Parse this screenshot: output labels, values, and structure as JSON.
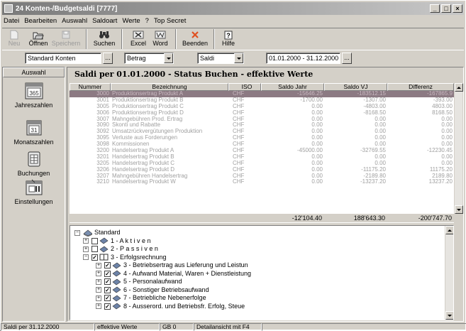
{
  "window": {
    "title": "24 Konten-/Budgetsaldi [7777]",
    "controls": [
      "_",
      "□",
      "×"
    ]
  },
  "menu": [
    "Datei",
    "Bearbeiten",
    "Auswahl",
    "Saldoart",
    "Werte",
    "?",
    "Top Secret"
  ],
  "toolbar": {
    "neu": "Neu",
    "oeffnen": "Öffnen",
    "speichern": "Speichern",
    "suchen": "Suchen",
    "excel": "Excel",
    "word": "Word",
    "beenden": "Beenden",
    "hilfe": "Hilfe"
  },
  "filters": {
    "konten": "Standard Konten",
    "dots": "...",
    "betrag": "Betrag",
    "saldi": "Saldi",
    "period": "01.01.2000 - 31.12.2000"
  },
  "sidebar": {
    "header": "Auswahl",
    "items": [
      {
        "label": "Jahreszahlen",
        "icon_text": "365"
      },
      {
        "label": "Monatszahlen",
        "icon_text": "31"
      },
      {
        "label": "Buchungen"
      },
      {
        "label": "Einstellungen"
      }
    ]
  },
  "main": {
    "title": "Saldi per 01.01.2000 - Status Buchen - effektive Werte"
  },
  "table": {
    "columns": [
      "Nummer",
      "Bezeichnung",
      "ISO",
      "Saldo Jahr",
      "Saldo VJ",
      "Differenz"
    ],
    "rows": [
      [
        "3000",
        "Produktionsertrag Produkt A",
        "CHF",
        "-15646.25",
        "-183512.15",
        "-167865.9"
      ],
      [
        "3001",
        "Produktionsertrag Produkt B",
        "CHF",
        "-1700.00",
        "-1307.00",
        "-393.00"
      ],
      [
        "3005",
        "Produktionsertrag Produkt C",
        "CHF",
        "0.00",
        "-4803.00",
        "4803.00"
      ],
      [
        "3006",
        "Produktionsertrag Produkt D",
        "CHF",
        "0.00",
        "-8168.50",
        "8168.50"
      ],
      [
        "3007",
        "Mahngebühren Prod. Ertrag",
        "CHF",
        "0.00",
        "0.00",
        "0.00"
      ],
      [
        "3090",
        "Skonti und Rabatte",
        "CHF",
        "0.00",
        "0.00",
        "0.00"
      ],
      [
        "3092",
        "Umsatzrückvergütungen Produktion",
        "CHF",
        "0.00",
        "0.00",
        "0.00"
      ],
      [
        "3095",
        "Verluste aus Forderungen",
        "CHF",
        "0.00",
        "0.00",
        "0.00"
      ],
      [
        "3098",
        "Kommissionen",
        "CHF",
        "0.00",
        "0.00",
        "0.00"
      ],
      [
        "3200",
        "Handelsertrag Produkt A",
        "CHF",
        "-45000.00",
        "-32769.55",
        "-12230.45"
      ],
      [
        "3201",
        "Handelsertrag Produkt B",
        "CHF",
        "0.00",
        "0.00",
        "0.00"
      ],
      [
        "3205",
        "Handelsertrag Produkt C",
        "CHF",
        "0.00",
        "0.00",
        "0.00"
      ],
      [
        "3206",
        "Handelsertrag Produkt D",
        "CHF",
        "0.00",
        "-11175.20",
        "11175.20"
      ],
      [
        "3207",
        "Mahngebühren Handelsertrag",
        "CHF",
        "0.00",
        "-2189.80",
        "2189.80"
      ],
      [
        "3210",
        "Handelsertrag Produkt W",
        "CHF",
        "0.00",
        "-13237.20",
        "13237.20"
      ]
    ],
    "totals": [
      "-12'104.40",
      "188'643.30",
      "-200'747.70"
    ]
  },
  "tree": [
    {
      "label": "Standard",
      "pm": "−",
      "level": 0,
      "checkbox": null
    },
    {
      "label": "1 - A k t i v e n",
      "pm": "+",
      "level": 1,
      "checkbox": ""
    },
    {
      "label": "2 - P a s s i v e n",
      "pm": "+",
      "level": 1,
      "checkbox": ""
    },
    {
      "label": "3 - Erfolgsrechnung",
      "pm": "−",
      "level": 1,
      "checkbox": "✓"
    },
    {
      "label": "3 - Betriebsertrag aus Lieferung und Leistun",
      "pm": "+",
      "level": 2,
      "checkbox": "✓"
    },
    {
      "label": "4 - Aufwand Material, Waren + Dienstleistung",
      "pm": "+",
      "level": 2,
      "checkbox": "✓"
    },
    {
      "label": "5 - Personalaufwand",
      "pm": "+",
      "level": 2,
      "checkbox": "✓"
    },
    {
      "label": "6 - Sonstiger Betriebsaufwand",
      "pm": "+",
      "level": 2,
      "checkbox": "✓"
    },
    {
      "label": "7 - Betriebliche Nebenerfolge",
      "pm": "+",
      "level": 2,
      "checkbox": "✓"
    },
    {
      "label": "8 - Ausserord. und Betriebsfr. Erfolg, Steue",
      "pm": "+",
      "level": 2,
      "checkbox": "✓"
    }
  ],
  "status": {
    "saldi": "Saldi per 31.12.2000",
    "werte": "effektive Werte",
    "gb": "GB 0",
    "detail": "Detailansicht mit F4"
  }
}
